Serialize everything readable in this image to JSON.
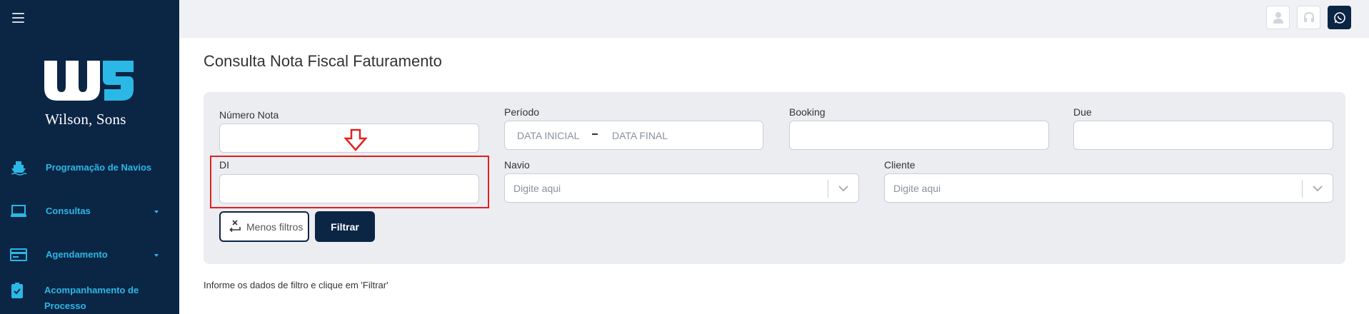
{
  "sidebar": {
    "brand": "Wilson, Sons",
    "items": [
      {
        "label": "Programação de Navios",
        "icon": "ship-icon",
        "has_caret": false
      },
      {
        "label": "Consultas",
        "icon": "laptop-icon",
        "has_caret": true
      },
      {
        "label": "Agendamento",
        "icon": "card-icon",
        "has_caret": true
      },
      {
        "label": "Acompanhamento de Processo",
        "icon": "clipboard-check-icon",
        "has_caret": false
      }
    ]
  },
  "topbar": {
    "buttons": [
      "user-icon",
      "headset-icon",
      "whatsapp-icon"
    ]
  },
  "page": {
    "title": "Consulta Nota Fiscal Faturamento",
    "hint": "Informe os dados de filtro e clique em 'Filtrar'"
  },
  "filters": {
    "numero_nota": {
      "label": "Número Nota",
      "value": ""
    },
    "periodo": {
      "label": "Período",
      "start_placeholder": "DATA INICIAL",
      "end_placeholder": "DATA FINAL"
    },
    "booking": {
      "label": "Booking",
      "value": ""
    },
    "due": {
      "label": "Due",
      "value": ""
    },
    "di": {
      "label": "DI",
      "value": ""
    },
    "navio": {
      "label": "Navio",
      "placeholder": "Digite aqui"
    },
    "cliente": {
      "label": "Cliente",
      "placeholder": "Digite aqui"
    },
    "less_filters_label": "Menos filtros",
    "filter_label": "Filtrar"
  },
  "colors": {
    "sidebar_bg": "#0b2545",
    "accent": "#2bb8e6",
    "highlight": "#e02020"
  }
}
